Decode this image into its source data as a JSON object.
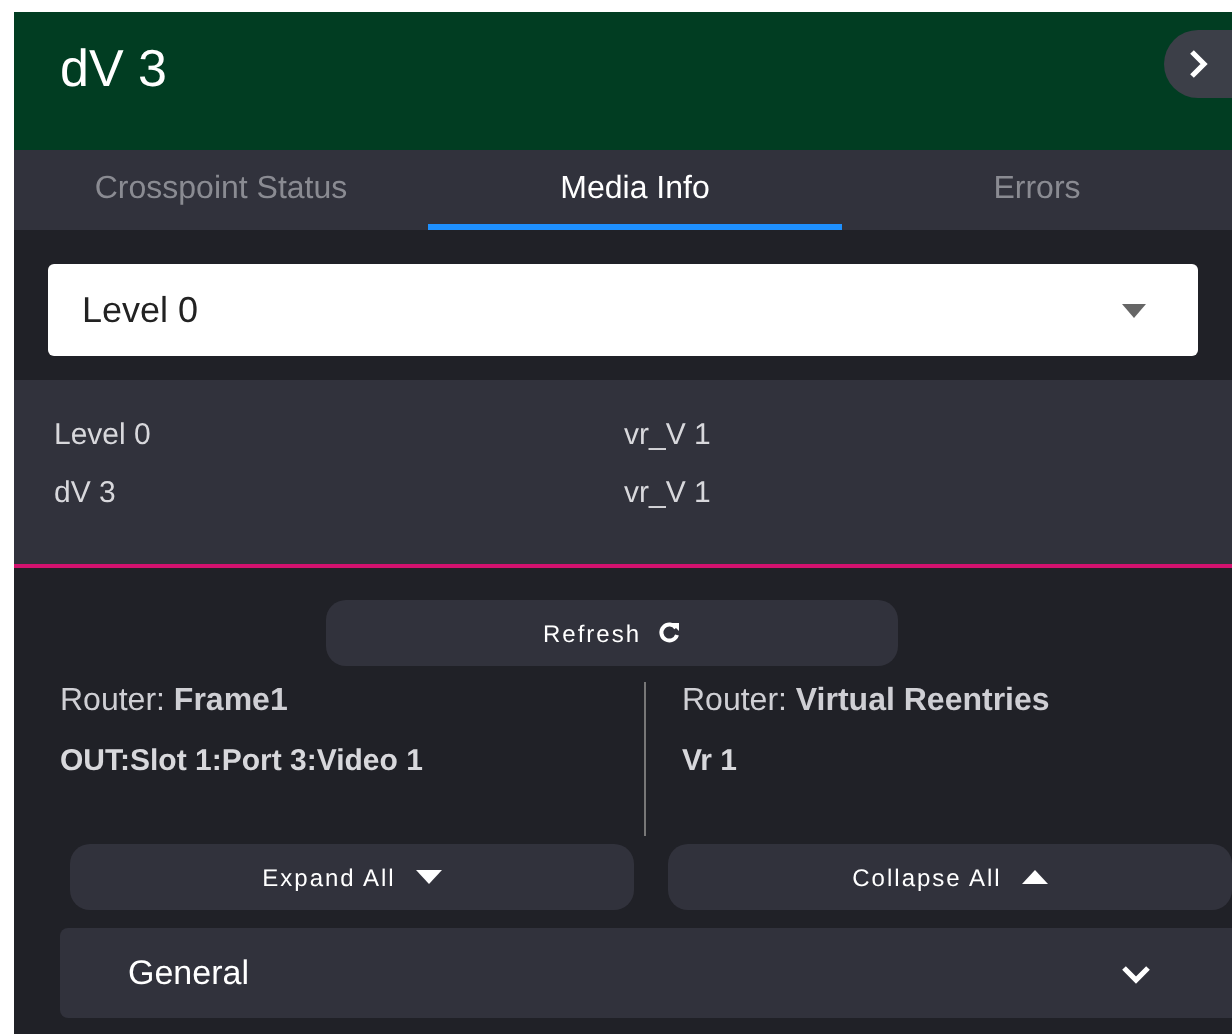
{
  "header": {
    "title": "dV 3"
  },
  "tabs": [
    {
      "label": "Crosspoint Status",
      "selected": false
    },
    {
      "label": "Media Info",
      "selected": true
    },
    {
      "label": "Errors",
      "selected": false
    }
  ],
  "level_select": {
    "value": "Level 0"
  },
  "info_rows": [
    {
      "name": "Level 0",
      "value": "vr_V 1"
    },
    {
      "name": "dV 3",
      "value": "vr_V 1"
    }
  ],
  "refresh_button": "Refresh",
  "routers": [
    {
      "label": "Router:",
      "router": "Frame1",
      "port": "OUT:Slot 1:Port 3:Video 1"
    },
    {
      "label": "Router:",
      "router": "Virtual Reentries",
      "port": "Vr 1"
    }
  ],
  "expand_button": "Expand All",
  "collapse_button": "Collapse All",
  "sections": [
    {
      "title": "General",
      "expanded": false
    }
  ]
}
